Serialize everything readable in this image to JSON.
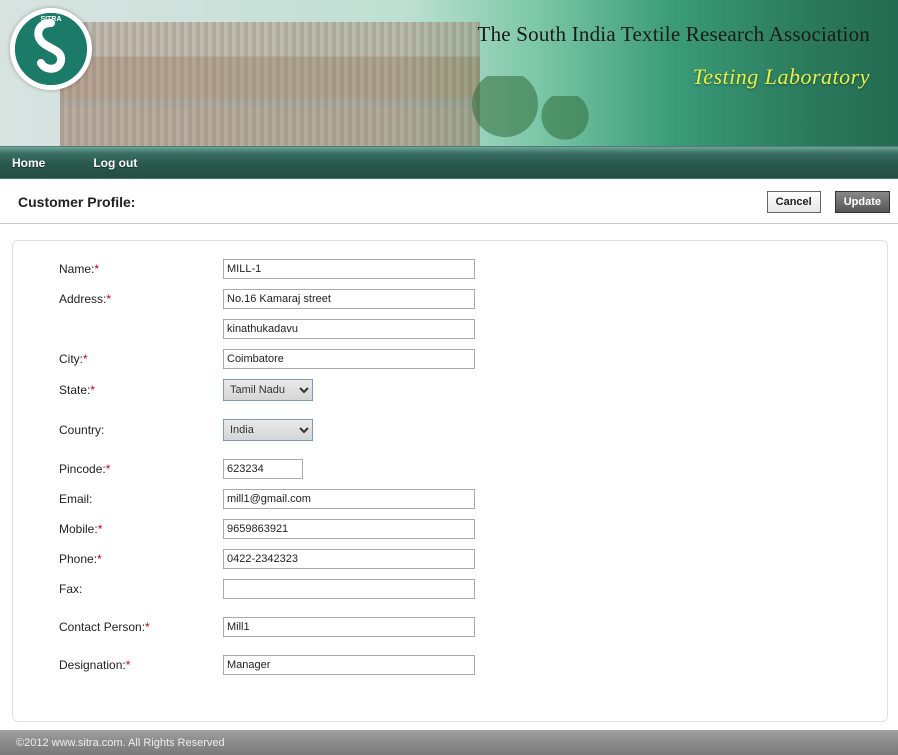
{
  "header": {
    "org_title": "The South India Textile Research Association",
    "subtitle": "Testing Laboratory",
    "logo_abbr": "SITRA"
  },
  "nav": {
    "home": "Home",
    "logout": "Log out"
  },
  "page": {
    "title": "Customer Profile:",
    "cancel_label": "Cancel",
    "update_label": "Update"
  },
  "form": {
    "labels": {
      "name": "Name:",
      "address": "Address:",
      "city": "City:",
      "state": "State:",
      "country": "Country:",
      "pincode": "Pincode:",
      "email": "Email:",
      "mobile": "Mobile:",
      "phone": "Phone:",
      "fax": "Fax:",
      "contact_person": "Contact Person:",
      "designation": "Designation:"
    },
    "values": {
      "name": "MILL-1",
      "address1": "No.16 Kamaraj street",
      "address2": "kinathukadavu",
      "city": "Coimbatore",
      "state": "Tamil Nadu",
      "country": "India",
      "pincode": "623234",
      "email": "mill1@gmail.com",
      "mobile": "9659863921",
      "phone": "0422-2342323",
      "fax": "",
      "contact_person": "Mill1",
      "designation": "Manager"
    }
  },
  "footer": {
    "text": "©2012 www.sitra.com. All Rights Reserved"
  }
}
